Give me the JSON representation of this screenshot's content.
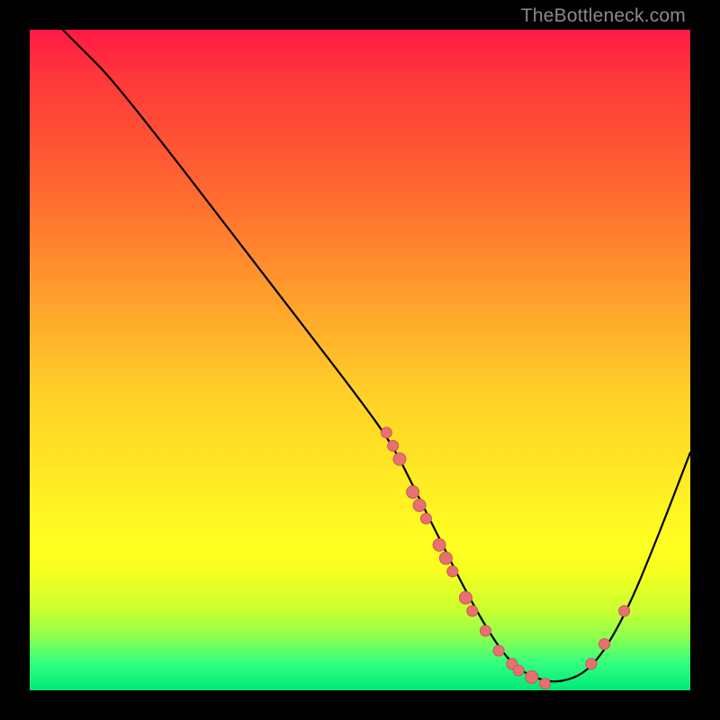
{
  "watermark": "TheBottleneck.com",
  "colors": {
    "background": "#000000",
    "gradient_top": "#ff1a44",
    "gradient_bottom": "#00e878",
    "curve": "#000000",
    "dot_fill": "#e87070",
    "dot_stroke": "#c85858"
  },
  "chart_data": {
    "type": "line",
    "title": "",
    "xlabel": "",
    "ylabel": "",
    "xlim": [
      0,
      100
    ],
    "ylim": [
      0,
      100
    ],
    "series": [
      {
        "name": "curve",
        "x": [
          5,
          8,
          12,
          20,
          30,
          40,
          50,
          55,
          58,
          62,
          66,
          70,
          73,
          76,
          80,
          85,
          90,
          95,
          100
        ],
        "y": [
          100,
          97,
          93,
          83,
          70,
          57,
          44,
          37,
          31,
          23,
          15,
          8,
          4,
          2,
          1,
          3,
          11,
          23,
          36
        ]
      }
    ],
    "scatter": {
      "name": "marked_points",
      "x": [
        54,
        55,
        56,
        58,
        59,
        60,
        62,
        63,
        64,
        66,
        67,
        69,
        71,
        73,
        74,
        76,
        78,
        85,
        87,
        90
      ],
      "y": [
        39,
        37,
        35,
        30,
        28,
        26,
        22,
        20,
        18,
        14,
        12,
        9,
        6,
        4,
        3,
        2,
        1,
        4,
        7,
        12
      ],
      "r": [
        6,
        6,
        7,
        7,
        7,
        6,
        7,
        7,
        6,
        7,
        6,
        6,
        6,
        6,
        6,
        7,
        6,
        6,
        6,
        6
      ]
    }
  }
}
